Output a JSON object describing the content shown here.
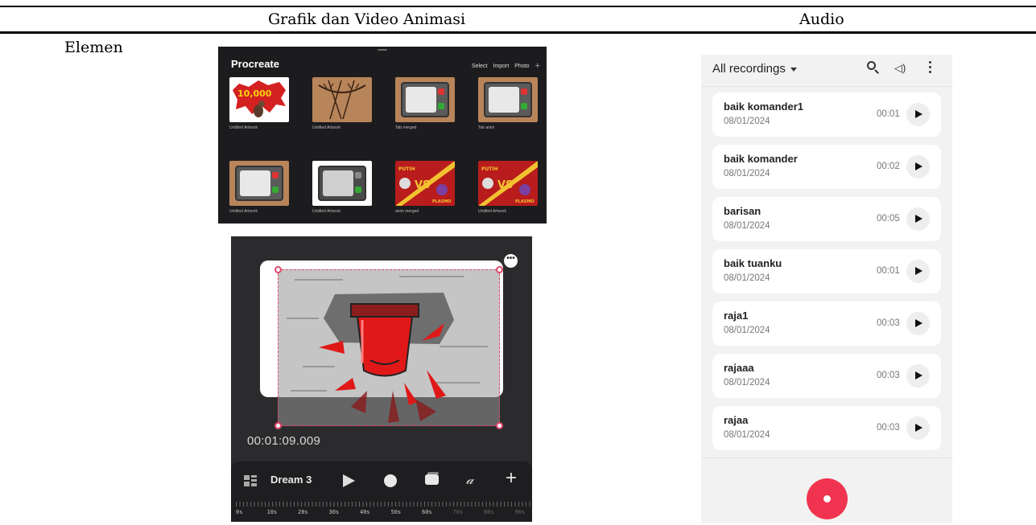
{
  "table": {
    "col_graphics": "Grafik dan Video Animasi",
    "col_audio": "Audio",
    "row_label": "Elemen"
  },
  "procreate": {
    "title": "Procreate",
    "actions": [
      "Select",
      "Import",
      "Photo"
    ],
    "artworks": [
      {
        "name": "Untitled Artwork",
        "thumb": "explosion-10000"
      },
      {
        "name": "Untitled Artwork",
        "thumb": "wood-stitched"
      },
      {
        "name": "Tab merged",
        "thumb": "tv-set"
      },
      {
        "name": "Tab anim",
        "thumb": "tv-set"
      },
      {
        "name": "Untitled Artwork",
        "thumb": "tv-set"
      },
      {
        "name": "Untitled Artwork",
        "thumb": "tv-set-grey"
      },
      {
        "name": "anim merged",
        "thumb": "versus-red"
      },
      {
        "name": "Untitled Artwork",
        "thumb": "versus-red"
      }
    ]
  },
  "animation": {
    "timecode": "00:01:09.009",
    "project_name": "Dream 3",
    "ruler_labels": [
      "0s",
      "10s",
      "20s",
      "30s",
      "40s",
      "50s",
      "60s",
      "70s",
      "80s",
      "90s"
    ],
    "ruler_dim_from_index": 7
  },
  "recorder": {
    "filter_label": "All recordings",
    "recordings": [
      {
        "name": "baik komander1",
        "date": "08/01/2024",
        "duration": "00:01"
      },
      {
        "name": "baik komander",
        "date": "08/01/2024",
        "duration": "00:02"
      },
      {
        "name": "barisan",
        "date": "08/01/2024",
        "duration": "00:05"
      },
      {
        "name": "baik tuanku",
        "date": "08/01/2024",
        "duration": "00:01"
      },
      {
        "name": "raja1",
        "date": "08/01/2024",
        "duration": "00:03"
      },
      {
        "name": "rajaaa",
        "date": "08/01/2024",
        "duration": "00:03"
      },
      {
        "name": "rajaa",
        "date": "08/01/2024",
        "duration": "00:03"
      }
    ],
    "accent_color": "#f0344f"
  }
}
